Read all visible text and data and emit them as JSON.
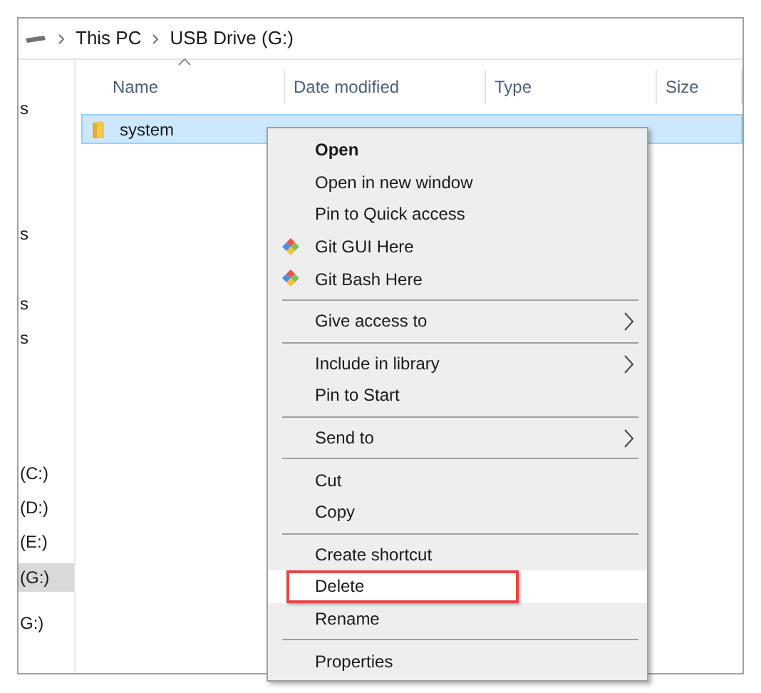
{
  "breadcrumb": [
    "This PC",
    "USB Drive (G:)"
  ],
  "nav_items": [
    {
      "label": "s",
      "selected": false
    },
    {
      "label": "s",
      "selected": false
    },
    {
      "label": "s",
      "selected": false
    },
    {
      "label": "s",
      "selected": false
    },
    {
      "label": "(C:)",
      "selected": false
    },
    {
      "label": "(D:)",
      "selected": false
    },
    {
      "label": "(E:)",
      "selected": false
    },
    {
      "label": "(G:)",
      "selected": true
    },
    {
      "label": "G:)",
      "selected": false
    }
  ],
  "columns": [
    {
      "label": "Name",
      "sorted": true
    },
    {
      "label": "Date modified",
      "sorted": false
    },
    {
      "label": "Type",
      "sorted": false
    },
    {
      "label": "Size",
      "sorted": false
    }
  ],
  "rows": [
    {
      "name": "system",
      "selected": true
    }
  ],
  "context_menu": [
    {
      "kind": "item",
      "label": "Open",
      "bold": true
    },
    {
      "kind": "item",
      "label": "Open in new window"
    },
    {
      "kind": "item",
      "label": "Pin to Quick access"
    },
    {
      "kind": "iconitem",
      "label": "Git GUI Here"
    },
    {
      "kind": "iconitem",
      "label": "Git Bash Here"
    },
    {
      "kind": "separator"
    },
    {
      "kind": "item",
      "label": "Give access to",
      "submenu": true
    },
    {
      "kind": "separator"
    },
    {
      "kind": "item",
      "label": "Include in library",
      "submenu": true
    },
    {
      "kind": "item",
      "label": "Pin to Start"
    },
    {
      "kind": "separator"
    },
    {
      "kind": "item",
      "label": "Send to",
      "submenu": true
    },
    {
      "kind": "separator"
    },
    {
      "kind": "item",
      "label": "Cut"
    },
    {
      "kind": "item",
      "label": "Copy"
    },
    {
      "kind": "separator"
    },
    {
      "kind": "item",
      "label": "Create shortcut"
    },
    {
      "kind": "item",
      "label": "Delete",
      "highlighted": true
    },
    {
      "kind": "item",
      "label": "Rename"
    },
    {
      "kind": "separator"
    },
    {
      "kind": "item",
      "label": "Properties"
    }
  ]
}
